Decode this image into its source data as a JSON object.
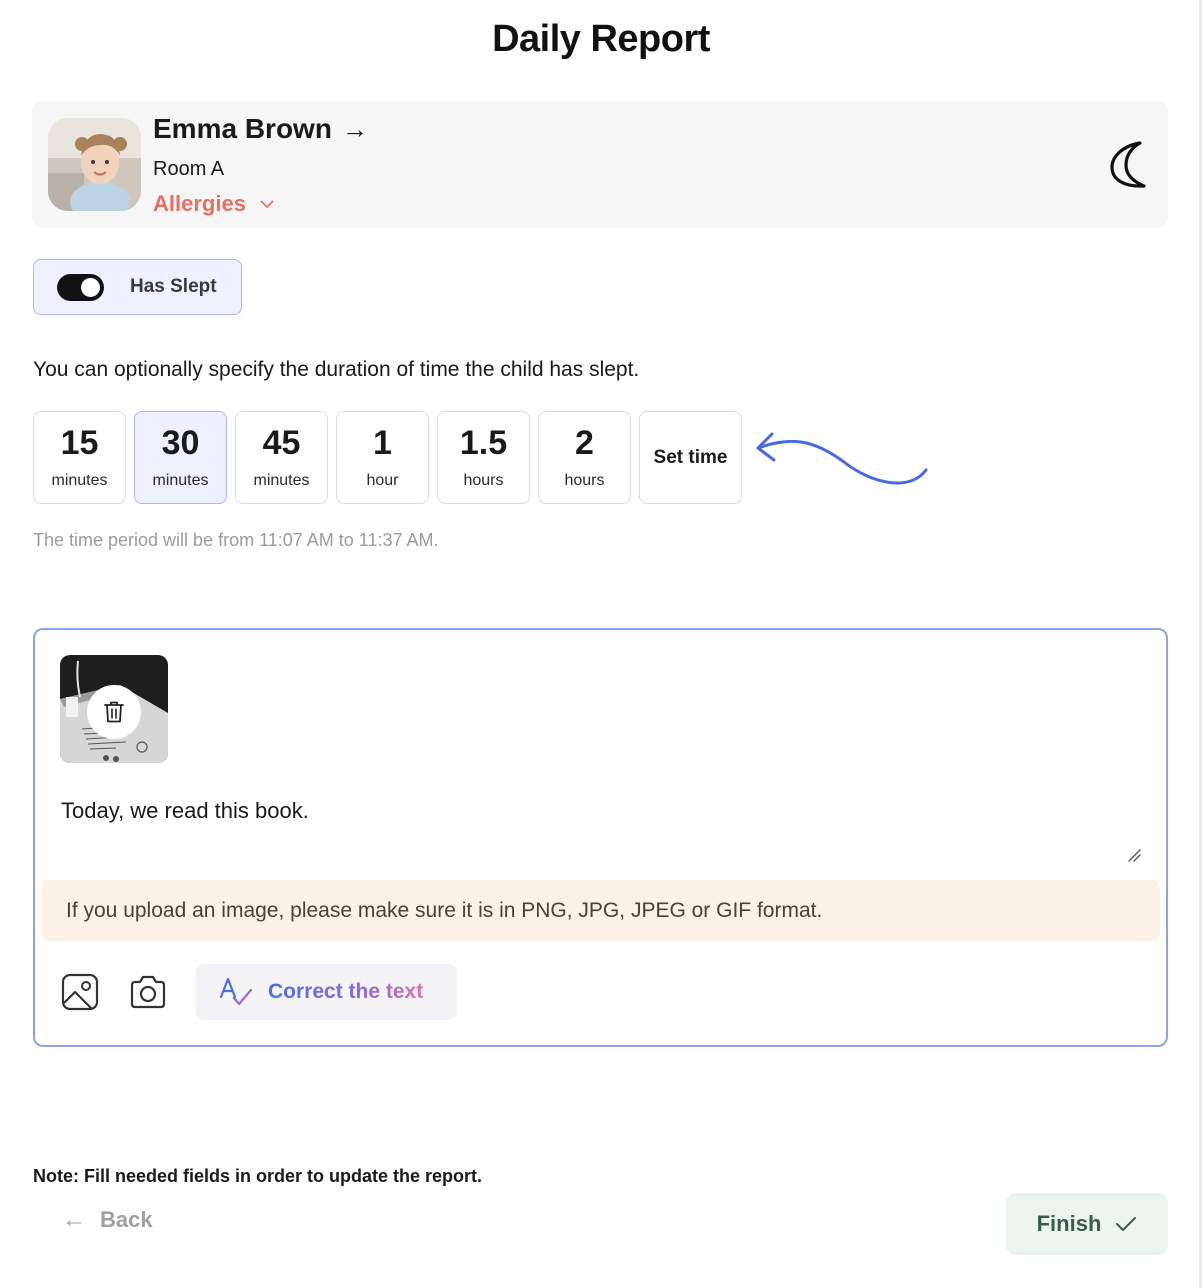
{
  "page": {
    "title": "Daily Report"
  },
  "child": {
    "name": "Emma Brown",
    "name_arrow": "→",
    "room": "Room A",
    "allergies_label": "Allergies",
    "avatar_icon": "child-photo",
    "mode_icon": "moon-icon"
  },
  "sleep": {
    "toggle_label": "Has Slept",
    "toggle_on": true,
    "hint": "You can optionally specify the duration of time the child has slept.",
    "options": [
      {
        "value": "15",
        "unit": "minutes",
        "selected": false
      },
      {
        "value": "30",
        "unit": "minutes",
        "selected": true
      },
      {
        "value": "45",
        "unit": "minutes",
        "selected": false
      },
      {
        "value": "1",
        "unit": "hour",
        "selected": false
      },
      {
        "value": "1.5",
        "unit": "hours",
        "selected": false
      },
      {
        "value": "2",
        "unit": "hours",
        "selected": false
      }
    ],
    "custom_label": "Set time",
    "period_text": "The time period will be from 11:07 AM to 11:37 AM."
  },
  "note": {
    "text": "Today, we read this book.",
    "attachment_icon": "book-photo-thumbnail",
    "format_warning": "If you upload an image, please make sure it is in PNG, JPG, JPEG or GIF format.",
    "correct_label": "Correct the text"
  },
  "footer": {
    "note": "Note: Fill needed fields in order to update the report.",
    "back_arrow": "←",
    "back_label": "Back",
    "finish_label": "Finish"
  },
  "colors": {
    "accent": "#8ea2e6",
    "allergy": "#e46f63",
    "selected_bg": "#eef0fd",
    "warning_bg": "#fbf1e7",
    "finish_bg": "#eaf5ef",
    "arrow": "#4a68e0"
  }
}
